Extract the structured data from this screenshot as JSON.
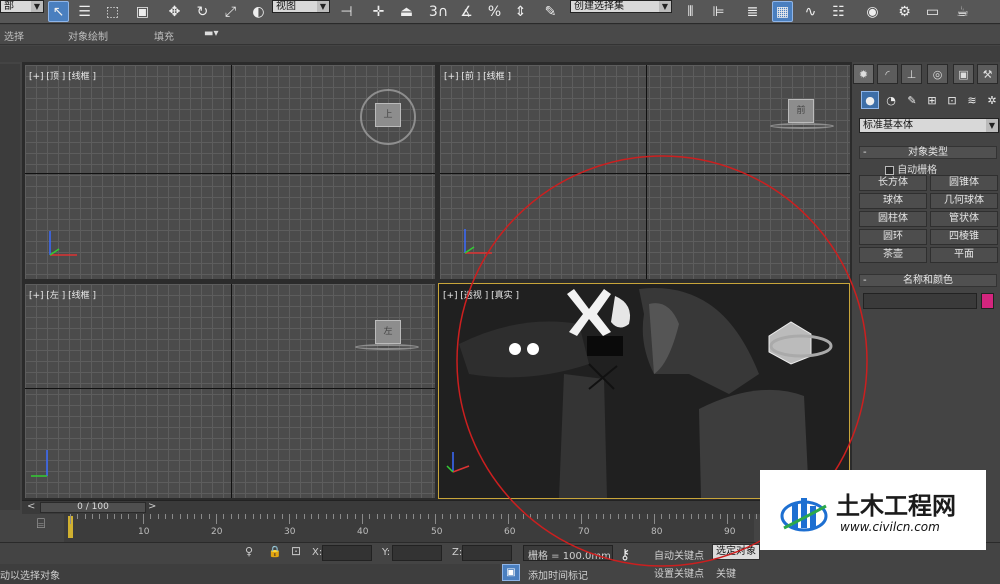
{
  "toolbar": {
    "left_dropdown": "部",
    "viewref_dropdown": "视图",
    "selection_set": "创建选择集",
    "icons": [
      "select-arrow-icon",
      "select-by-name-icon",
      "rect-region-icon",
      "window-crossing-icon",
      "move-icon",
      "rotate-icon",
      "scale-icon",
      "view-ref-icon",
      "pivot-icon",
      "select-manipulate-icon",
      "snap-3-icon",
      "angle-snap-icon",
      "percent-snap-icon",
      "spinner-snap-icon",
      "edit-named-sel-icon",
      "mirror-icon",
      "align-icon",
      "layer-icon",
      "graphite-icon",
      "curve-editor-icon",
      "schematic-icon",
      "material-editor-icon",
      "render-setup-icon",
      "render-frame-icon",
      "render-icon"
    ],
    "snap_number": "3"
  },
  "ribbon": {
    "items": [
      "选择",
      "对象绘制",
      "填充"
    ]
  },
  "viewports": {
    "top": {
      "label": "[+] [顶 ] [线框 ]",
      "cube": "上"
    },
    "front": {
      "label": "[+] [前 ] [线框 ]",
      "cube": "前"
    },
    "left": {
      "label": "[+] [左 ] [线框 ]",
      "cube": "左"
    },
    "persp": {
      "label": "[+] [透视 ] [真实 ]"
    }
  },
  "command_panel": {
    "tabs": [
      "create-tab-icon",
      "modify-tab-icon",
      "hierarchy-tab-icon",
      "motion-tab-icon",
      "display-tab-icon",
      "utilities-tab-icon"
    ],
    "subtabs": [
      "geometry-icon",
      "shapes-icon",
      "lights-icon",
      "cameras-icon",
      "helpers-icon",
      "spacewarps-icon",
      "systems-icon"
    ],
    "category": "标准基本体",
    "object_type": {
      "title": "对象类型",
      "autogrid": "自动栅格",
      "buttons": [
        "长方体",
        "圆锥体",
        "球体",
        "几何球体",
        "圆柱体",
        "管状体",
        "圆环",
        "四棱锥",
        "茶壶",
        "平面"
      ]
    },
    "name_color": {
      "title": "名称和颜色",
      "color": "#d4257e"
    }
  },
  "timeline": {
    "frame": "0 / 100",
    "prev": "<",
    "next": ">"
  },
  "trackbar": {
    "ticks": [
      "10",
      "20",
      "30",
      "40",
      "50",
      "60",
      "70",
      "80",
      "90"
    ]
  },
  "status": {
    "prompt": "动以选择对象",
    "x_label": "X:",
    "y_label": "Y:",
    "z_label": "Z:",
    "grid": "栅格 = 100.0mm",
    "auto_key": "自动关键点",
    "set_key": "设置关键点",
    "selected": "选定对象",
    "add_time_tag": "添加时间标记",
    "key_filter": "关键"
  },
  "watermark": {
    "name": "土木工程网",
    "url": "www.civilcn.com"
  },
  "annotation_color": "#cc1f1f"
}
